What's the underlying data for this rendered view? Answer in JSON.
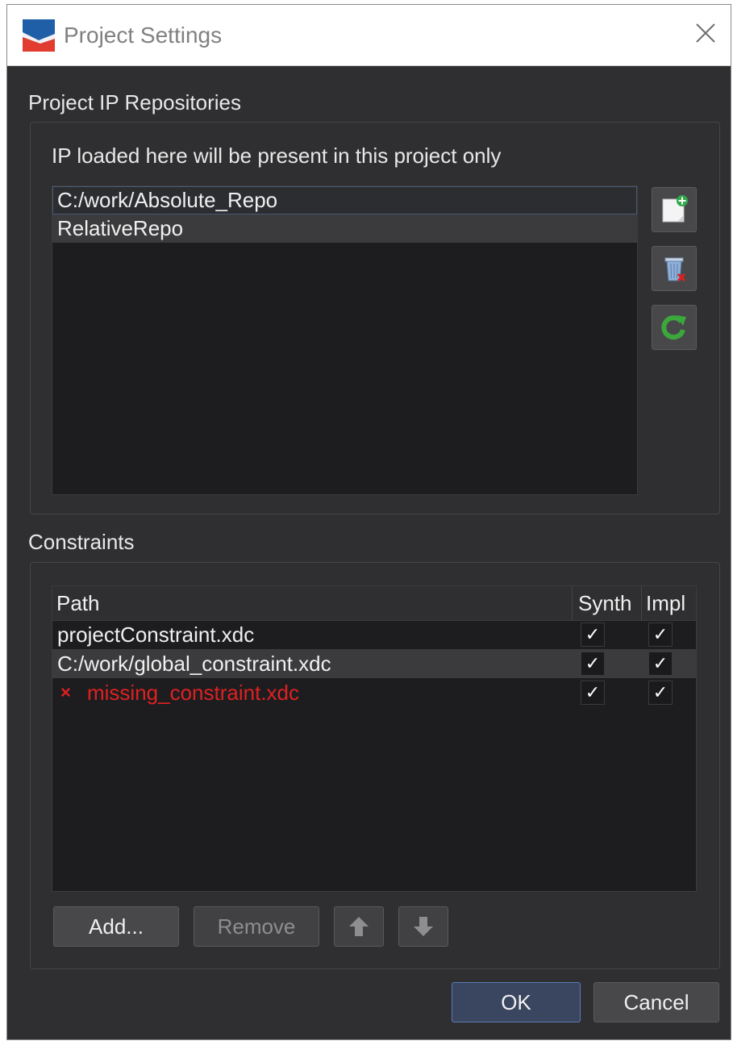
{
  "window": {
    "title": "Project Settings"
  },
  "ip_repositories": {
    "section_label": "Project IP Repositories",
    "description": "IP loaded here will be present in this project only",
    "items": [
      {
        "label": "C:/work/Absolute_Repo",
        "selected": true
      },
      {
        "label": "RelativeRepo",
        "selected": false
      }
    ],
    "buttons": [
      {
        "name": "add-repository-button",
        "icon": "new-document-plus-icon"
      },
      {
        "name": "remove-repository-button",
        "icon": "trash-icon"
      },
      {
        "name": "refresh-repository-button",
        "icon": "refresh-icon"
      }
    ]
  },
  "constraints": {
    "section_label": "Constraints",
    "columns": {
      "path": "Path",
      "synth": "Synth",
      "impl": "Impl"
    },
    "rows": [
      {
        "path": "projectConstraint.xdc",
        "synth": true,
        "impl": true,
        "missing": false
      },
      {
        "path": "C:/work/global_constraint.xdc",
        "synth": true,
        "impl": true,
        "missing": false
      },
      {
        "path": "missing_constraint.xdc",
        "synth": true,
        "impl": true,
        "missing": true,
        "status_icon": "error-x-icon"
      }
    ],
    "buttons": {
      "add": "Add...",
      "remove": "Remove",
      "move_up_icon": "arrow-up-icon",
      "move_down_icon": "arrow-down-icon"
    }
  },
  "dialog_buttons": {
    "ok": "OK",
    "cancel": "Cancel"
  },
  "checkmark": "✓",
  "error_mark": "×",
  "colors": {
    "error": "#e02020",
    "background": "#2f2f31",
    "list_bg": "#1d1d20"
  }
}
